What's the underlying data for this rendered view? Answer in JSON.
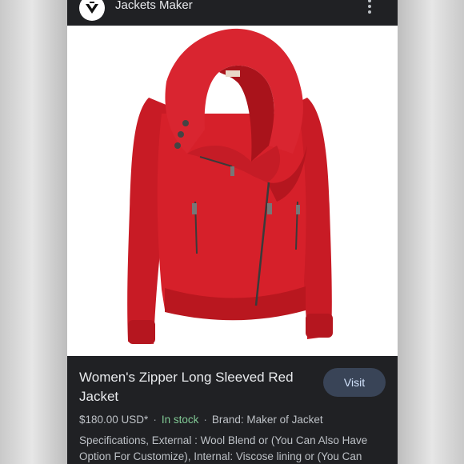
{
  "header": {
    "site_name": "Jackets Maker",
    "menu_icon": "more-vert-icon"
  },
  "product": {
    "image_subject": "red-zip-jacket",
    "title": "Women's Zipper Long Sleeved Red Jacket",
    "visit_label": "Visit",
    "price": "$180.00 USD*",
    "separator": "·",
    "stock": "In stock",
    "brand": "Brand: Maker of Jacket",
    "specs": "Specifications, External : Wool Blend or (You Can Also Have Option For Customize), Internal: Viscose lining or (You Can"
  },
  "colors": {
    "background_dark": "#202124",
    "jacket_red": "#d6202a",
    "in_stock": "#81c995",
    "visit_button": "#394457"
  }
}
